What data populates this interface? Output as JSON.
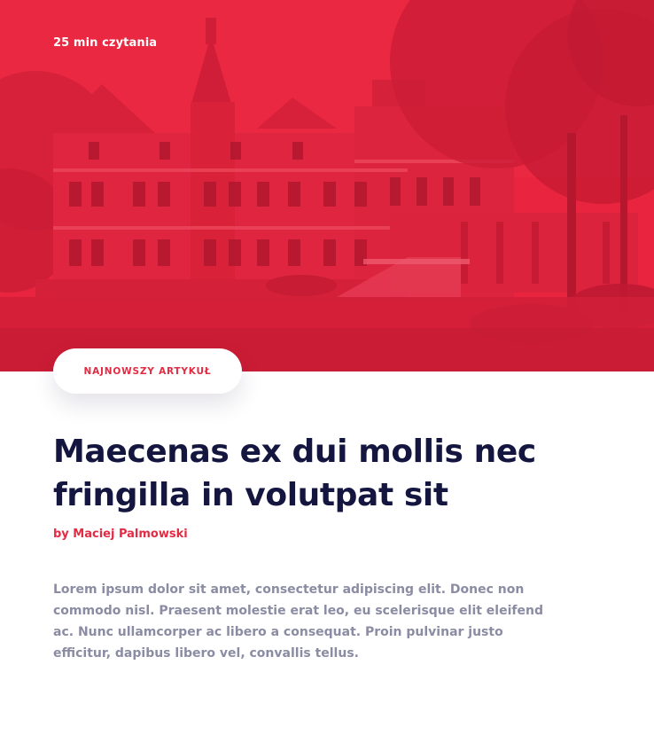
{
  "hero": {
    "read_time": "25 min czytania",
    "overlay_color": "#e8243f"
  },
  "badge": {
    "label": "NAJNOWSZY ARTYKUŁ"
  },
  "article": {
    "title": "Maecenas ex dui mollis nec fringilla in volutpat sit",
    "author": "by Maciej Palmowski",
    "excerpt": "Lorem ipsum dolor sit amet, consectetur adipiscing elit. Donec non commodo nisl. Praesent molestie erat leo, eu scelerisque elit eleifend ac. Nunc ullamcorper ac libero a consequat. Proin pulvinar justo efficitur, dapibus libero vel, convallis tellus."
  },
  "colors": {
    "accent": "#e32b43",
    "title": "#14163f",
    "muted": "#8b8ca3"
  }
}
